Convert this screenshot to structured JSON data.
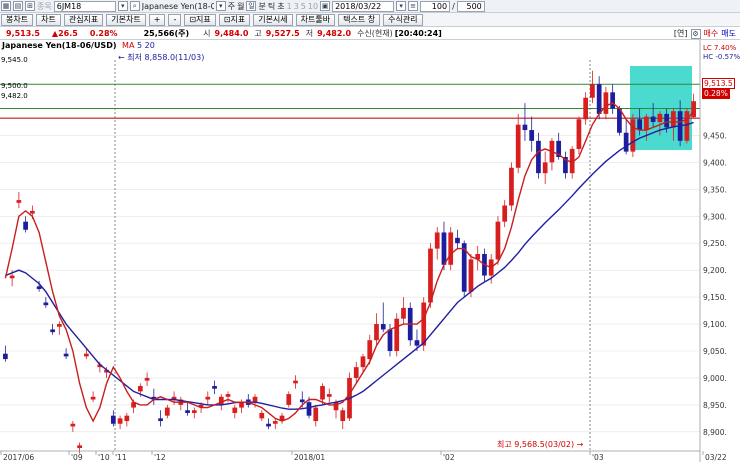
{
  "toolbar": {
    "symbol": "6JM18",
    "symbol_name": "Japanese Yen(18-06/US",
    "period_week": "주",
    "period_month": "월",
    "period_day": "일",
    "period_min": "분",
    "period_tick": "틱",
    "period_sec": "초",
    "n1": "1",
    "n3": "3",
    "n5": "5",
    "n10": "10",
    "date": "2018/03/22",
    "count": "100",
    "max_count": "500",
    "btn_basic_market": "기본시세",
    "btn_toolbar": "차트툴바",
    "btn_text": "텍스트 창",
    "btn_formula": "수식관리",
    "tab_bong": "봉차트",
    "tab_chart": "차트",
    "tab_watch": "관심지표",
    "tab_jipyo": "지표",
    "tab_ganggi": "강기",
    "tab_min": "분",
    "tab_day": "일",
    "tab_blank": "",
    "tab_plus": "+",
    "tab_minus": "-",
    "tab_jipyo2": "지표",
    "tab_basic": "기본차트",
    "tab_pillar": "기둥",
    "right_label_year": "[연]",
    "right_buy": "매수",
    "right_sell": "매도",
    "tab_extra1": "⊡지표",
    "tab_extra2": "⊡지표"
  },
  "info": {
    "price": "9,513.5",
    "change": "▲26.5",
    "change_pct": "0.28%",
    "volume": "25,566(주)",
    "open_label": "시",
    "open": "9,484.0",
    "high_label": "고",
    "high": "9,527.5",
    "low_label": "저",
    "low": "9,482.0",
    "mode": "수신(현재)",
    "time": "[20:40:24]"
  },
  "chart": {
    "title": "Japanese Yen(18-06/USD)",
    "ma_label": "MA",
    "ma_periods": "5  20",
    "low_annotation": "최저 8,858.0(11/03)",
    "high_annotation": "최고 9,568.5(03/02)",
    "lc_label": "LC",
    "lc_value": "7.40%",
    "hc_label": "HC",
    "hc_value": "-0.57%",
    "last_price_tag": "9,513.5",
    "last_pct_tag": "0.28%",
    "hline_labels": [
      "9,545.0",
      "9,500.0",
      "9,482.0"
    ],
    "x_labels": [
      "2017/06",
      "'09",
      "'10",
      "'11",
      "'12",
      "2018/01",
      "'02",
      "'03",
      "03/22"
    ],
    "colors": {
      "up": "#d81e1e",
      "down": "#1d1d9e",
      "ma5": "#c81e1e",
      "ma20": "#1f1fa0",
      "box": "#2ad3c8",
      "grid": "#e3e3e3",
      "hline_green": "#2e8b2e",
      "hline_red": "#b81e1e"
    }
  },
  "chart_data": {
    "type": "candlestick",
    "title": "Japanese Yen(18-06/USD)",
    "y_ticks": [
      9450,
      9400,
      9350,
      9300,
      9250,
      9200,
      9150,
      9100,
      9050,
      9000,
      8950,
      8900
    ],
    "y_tick_labels": [
      "9,450.",
      "9,400.",
      "9,350.",
      "9,300.",
      "9,250.",
      "9,200.",
      "9,150.",
      "9,100.",
      "9,050.",
      "9,000.",
      "8,950.",
      "8,900."
    ],
    "ylim": [
      8870,
      9590
    ],
    "candles": [
      [
        9045,
        9060,
        9030,
        9035
      ],
      [
        9185,
        9200,
        9170,
        9190
      ],
      [
        9325,
        9345,
        9315,
        9330
      ],
      [
        9290,
        9300,
        9270,
        9275
      ],
      [
        9305,
        9320,
        9295,
        9310
      ],
      [
        9170,
        9180,
        9160,
        9165
      ],
      [
        9140,
        9150,
        9130,
        9135
      ],
      [
        9090,
        9100,
        9080,
        9085
      ],
      [
        9095,
        9105,
        9080,
        9100
      ],
      [
        9045,
        9055,
        9035,
        9040
      ],
      [
        8910,
        8920,
        8900,
        8915
      ],
      [
        8870,
        8880,
        8860,
        8875
      ],
      [
        9040,
        9055,
        9035,
        9045
      ],
      [
        8960,
        8975,
        8955,
        8965
      ],
      [
        9020,
        9030,
        9010,
        9025
      ],
      [
        9010,
        9020,
        9000,
        9015
      ],
      [
        8930,
        8940,
        8910,
        8915
      ],
      [
        8915,
        8930,
        8905,
        8925
      ],
      [
        8920,
        8935,
        8910,
        8930
      ],
      [
        8945,
        8960,
        8935,
        8955
      ],
      [
        8975,
        8990,
        8965,
        8985
      ],
      [
        8995,
        9010,
        8985,
        9000
      ],
      [
        8965,
        8980,
        8950,
        8960
      ],
      [
        8925,
        8940,
        8910,
        8920
      ],
      [
        8930,
        8950,
        8925,
        8945
      ],
      [
        8960,
        8975,
        8950,
        8965
      ],
      [
        8950,
        8965,
        8940,
        8960
      ],
      [
        8940,
        8955,
        8930,
        8935
      ],
      [
        8935,
        8945,
        8925,
        8940
      ],
      [
        8945,
        8955,
        8935,
        8950
      ],
      [
        8960,
        8975,
        8950,
        8965
      ],
      [
        8985,
        8995,
        8970,
        8980
      ],
      [
        8950,
        8970,
        8940,
        8965
      ],
      [
        8965,
        8975,
        8955,
        8970
      ],
      [
        8935,
        8950,
        8925,
        8945
      ],
      [
        8945,
        8960,
        8935,
        8955
      ],
      [
        8960,
        8970,
        8945,
        8950
      ],
      [
        8955,
        8970,
        8945,
        8965
      ],
      [
        8925,
        8940,
        8920,
        8935
      ],
      [
        8915,
        8925,
        8905,
        8910
      ],
      [
        8915,
        8925,
        8905,
        8920
      ],
      [
        8920,
        8935,
        8915,
        8930
      ],
      [
        8950,
        8975,
        8945,
        8970
      ],
      [
        8990,
        9005,
        8980,
        8995
      ],
      [
        8960,
        8975,
        8945,
        8955
      ],
      [
        8955,
        8965,
        8925,
        8930
      ],
      [
        8920,
        8950,
        8910,
        8945
      ],
      [
        8960,
        8990,
        8950,
        8985
      ],
      [
        8965,
        8980,
        8955,
        8970
      ],
      [
        8940,
        8960,
        8925,
        8955
      ],
      [
        8920,
        8945,
        8905,
        8940
      ],
      [
        8925,
        9010,
        8920,
        9000
      ],
      [
        9000,
        9030,
        8990,
        9020
      ],
      [
        9020,
        9045,
        9010,
        9040
      ],
      [
        9035,
        9080,
        9025,
        9070
      ],
      [
        9070,
        9120,
        9060,
        9100
      ],
      [
        9100,
        9140,
        9085,
        9090
      ],
      [
        9090,
        9100,
        9040,
        9050
      ],
      [
        9050,
        9120,
        9040,
        9110
      ],
      [
        9110,
        9150,
        9100,
        9130
      ],
      [
        9130,
        9140,
        9060,
        9070
      ],
      [
        9070,
        9090,
        9050,
        9060
      ],
      [
        9060,
        9150,
        9050,
        9140
      ],
      [
        9140,
        9250,
        9130,
        9240
      ],
      [
        9240,
        9280,
        9220,
        9270
      ],
      [
        9270,
        9290,
        9200,
        9210
      ],
      [
        9210,
        9280,
        9200,
        9270
      ],
      [
        9260,
        9275,
        9240,
        9250
      ],
      [
        9250,
        9255,
        9150,
        9160
      ],
      [
        9160,
        9230,
        9150,
        9220
      ],
      [
        9220,
        9245,
        9200,
        9230
      ],
      [
        9230,
        9240,
        9180,
        9190
      ],
      [
        9190,
        9230,
        9175,
        9220
      ],
      [
        9220,
        9300,
        9210,
        9290
      ],
      [
        9290,
        9330,
        9280,
        9320
      ],
      [
        9320,
        9400,
        9310,
        9390
      ],
      [
        9390,
        9490,
        9380,
        9470
      ],
      [
        9470,
        9510,
        9440,
        9460
      ],
      [
        9460,
        9485,
        9420,
        9440
      ],
      [
        9440,
        9455,
        9370,
        9380
      ],
      [
        9380,
        9420,
        9360,
        9400
      ],
      [
        9400,
        9445,
        9385,
        9440
      ],
      [
        9440,
        9455,
        9405,
        9410
      ],
      [
        9410,
        9420,
        9370,
        9380
      ],
      [
        9380,
        9430,
        9370,
        9425
      ],
      [
        9425,
        9485,
        9415,
        9480
      ],
      [
        9480,
        9530,
        9470,
        9520
      ],
      [
        9520,
        9570,
        9510,
        9545
      ],
      [
        9545,
        9560,
        9480,
        9490
      ],
      [
        9490,
        9540,
        9480,
        9530
      ],
      [
        9530,
        9545,
        9490,
        9500
      ],
      [
        9500,
        9505,
        9450,
        9455
      ],
      [
        9455,
        9480,
        9415,
        9420
      ],
      [
        9420,
        9490,
        9410,
        9480
      ],
      [
        9480,
        9500,
        9450,
        9460
      ],
      [
        9460,
        9490,
        9440,
        9485
      ],
      [
        9485,
        9510,
        9465,
        9475
      ],
      [
        9475,
        9495,
        9450,
        9490
      ],
      [
        9490,
        9500,
        9455,
        9465
      ],
      [
        9465,
        9500,
        9440,
        9495
      ],
      [
        9495,
        9515,
        9430,
        9440
      ],
      [
        9440,
        9500,
        9435,
        9495
      ],
      [
        9484,
        9527.5,
        9482,
        9513.5
      ]
    ],
    "ma5": [
      9185,
      9240,
      9300,
      9310,
      9300,
      9270,
      9215,
      9160,
      9115,
      9090,
      9050,
      8990,
      8945,
      8920,
      8945,
      8990,
      9020,
      9000,
      8975,
      8955,
      8950,
      8950,
      8960,
      8965,
      8960,
      8955,
      8955,
      8955,
      8950,
      8945,
      8945,
      8950,
      8955,
      8960,
      8955,
      8955,
      8955,
      8950,
      8945,
      8935,
      8925,
      8920,
      8925,
      8935,
      8950,
      8960,
      8960,
      8955,
      8950,
      8950,
      8955,
      8970,
      8990,
      9010,
      9030,
      9060,
      9080,
      9090,
      9095,
      9100,
      9100,
      9100,
      9110,
      9140,
      9180,
      9210,
      9230,
      9240,
      9240,
      9225,
      9220,
      9210,
      9205,
      9215,
      9240,
      9280,
      9330,
      9375,
      9405,
      9420,
      9425,
      9420,
      9415,
      9405,
      9400,
      9410,
      9440,
      9470,
      9490,
      9505,
      9510,
      9500,
      9480,
      9465,
      9460,
      9460,
      9465,
      9470,
      9475,
      9475,
      9475,
      9480,
      9495
    ],
    "ma20": [
      9190,
      9195,
      9200,
      9195,
      9185,
      9175,
      9160,
      9140,
      9120,
      9100,
      9085,
      9070,
      9055,
      9040,
      9025,
      9015,
      9005,
      8995,
      8985,
      8975,
      8970,
      8965,
      8960,
      8960,
      8960,
      8960,
      8958,
      8956,
      8954,
      8952,
      8950,
      8950,
      8950,
      8952,
      8954,
      8955,
      8955,
      8955,
      8953,
      8950,
      8947,
      8944,
      8942,
      8942,
      8943,
      8945,
      8948,
      8950,
      8953,
      8955,
      8958,
      8962,
      8968,
      8975,
      8985,
      8995,
      9005,
      9015,
      9025,
      9035,
      9045,
      9055,
      9065,
      9080,
      9095,
      9110,
      9125,
      9140,
      9150,
      9160,
      9170,
      9178,
      9185,
      9195,
      9205,
      9218,
      9232,
      9248,
      9262,
      9275,
      9288,
      9300,
      9312,
      9325,
      9338,
      9352,
      9365,
      9378,
      9390,
      9402,
      9412,
      9422,
      9430,
      9438,
      9445,
      9450,
      9455,
      9460,
      9463,
      9466,
      9468,
      9470,
      9474
    ]
  }
}
